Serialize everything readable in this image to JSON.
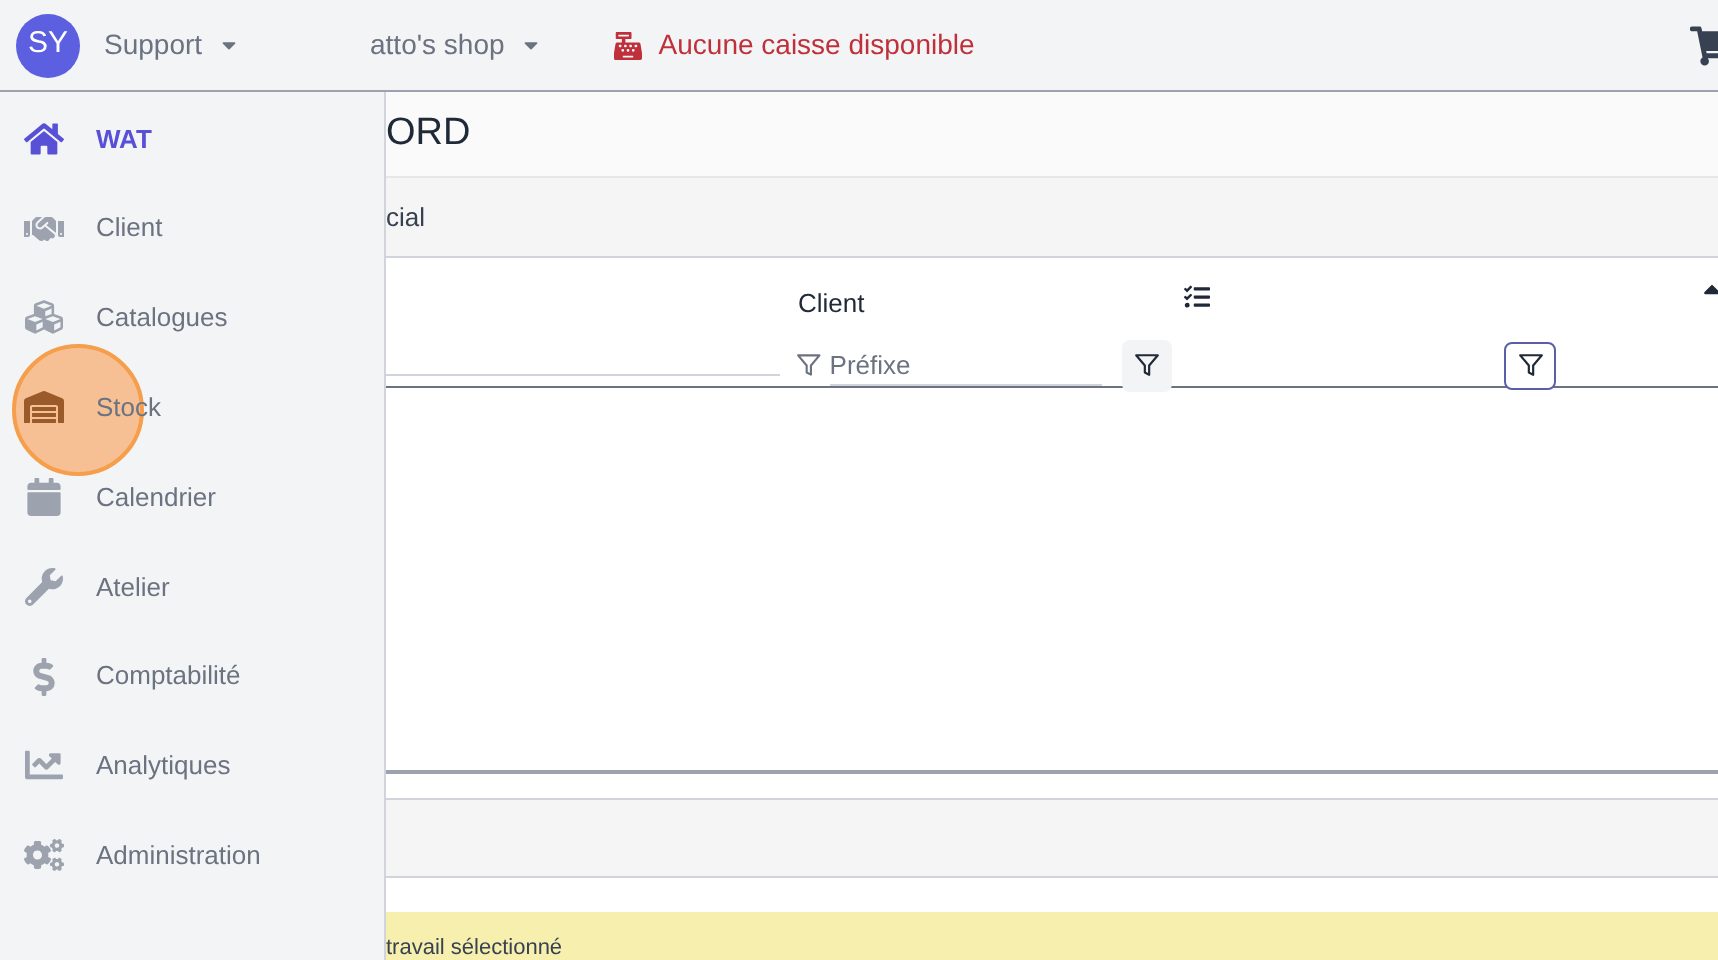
{
  "topbar": {
    "avatar": "SY",
    "user_menu": "Support",
    "shop_menu": "atto's shop",
    "register_status": "Aucune caisse disponible"
  },
  "sidebar": {
    "items": [
      {
        "label": "WAT",
        "selected": true
      },
      {
        "label": "Client",
        "selected": false
      },
      {
        "label": "Catalogues",
        "selected": false
      },
      {
        "label": "Stock",
        "selected": false,
        "clicked": true
      },
      {
        "label": "Calendrier",
        "selected": false
      },
      {
        "label": "Atelier",
        "selected": false
      },
      {
        "label": "Comptabilité",
        "selected": false
      },
      {
        "label": "Analytiques",
        "selected": false
      },
      {
        "label": "Administration",
        "selected": false
      }
    ]
  },
  "page": {
    "title": "ORD",
    "tab": "cial",
    "table": {
      "columns": [
        {
          "label": "Client",
          "placeholder": "Préfixe"
        }
      ]
    },
    "notice": "travail sélectionné"
  }
}
